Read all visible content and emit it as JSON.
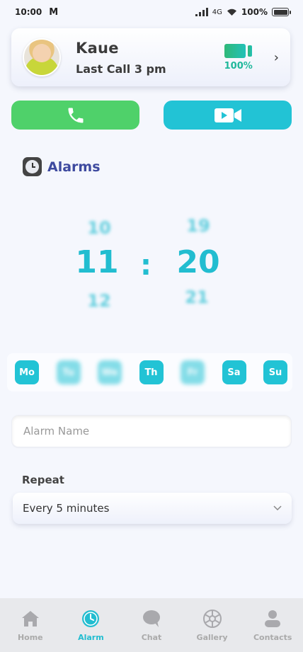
{
  "status_bar": {
    "time": "10:00",
    "carrier_glyph": "M",
    "network": "4G",
    "battery_pct": "100%"
  },
  "profile": {
    "name": "Kaue",
    "last_call": "Last Call 3 pm",
    "battery": "100%"
  },
  "alarms": {
    "title": "Alarms",
    "hours": [
      "10",
      "11",
      "12"
    ],
    "minutes": [
      "19",
      "20",
      "21"
    ],
    "separator": ":"
  },
  "days": [
    {
      "label": "Mo",
      "selected": true
    },
    {
      "label": "Tu",
      "selected": false
    },
    {
      "label": "We",
      "selected": false
    },
    {
      "label": "Th",
      "selected": true
    },
    {
      "label": "Fr",
      "selected": false
    },
    {
      "label": "Sa",
      "selected": true
    },
    {
      "label": "Su",
      "selected": true
    }
  ],
  "alarm_name": {
    "placeholder": "Alarm Name",
    "value": ""
  },
  "repeat": {
    "label": "Repeat",
    "value": "Every 5 minutes"
  },
  "nav": [
    {
      "label": "Home",
      "icon": "home-icon",
      "active": false
    },
    {
      "label": "Alarm",
      "icon": "alarm-clock-icon",
      "active": true
    },
    {
      "label": "Chat",
      "icon": "chat-bubble-icon",
      "active": false
    },
    {
      "label": "Gallery",
      "icon": "aperture-icon",
      "active": false
    },
    {
      "label": "Contacts",
      "icon": "person-icon",
      "active": false
    }
  ],
  "colors": {
    "accent": "#22bdd0",
    "call_green": "#4fd16a",
    "video_cyan": "#22c3d5",
    "title_blue": "#3e4a9f",
    "battery_green": "#20b89b"
  }
}
